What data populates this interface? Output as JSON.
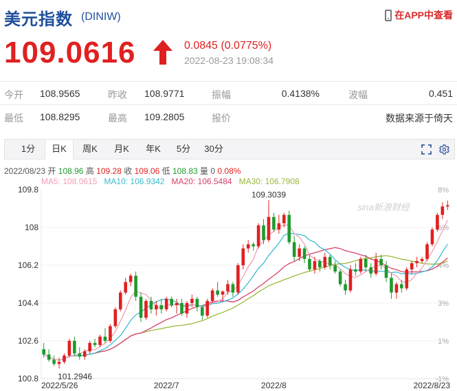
{
  "header": {
    "title": "美元指数",
    "code": "(DINIW)",
    "app_link": "在APP中查看",
    "icon": "phone-icon"
  },
  "quote": {
    "price": "109.0616",
    "arrow_icon": "up-arrow-icon",
    "change": "0.0845 (0.0775%)",
    "datetime": "2022-08-23 19:08:34"
  },
  "stats": {
    "row1": [
      {
        "label": "今开",
        "value": "108.9565"
      },
      {
        "label": "昨收",
        "value": "108.9771"
      },
      {
        "label": "振幅",
        "value": "0.4138%"
      },
      {
        "label": "波幅",
        "value": "0.451"
      }
    ],
    "row2": [
      {
        "label": "最低",
        "value": "108.8295"
      },
      {
        "label": "最高",
        "value": "109.2805"
      },
      {
        "label": "报价",
        "value": ""
      },
      {
        "label": "",
        "value": "数据来源于倚天"
      }
    ]
  },
  "tabs": [
    "1分",
    "日K",
    "周K",
    "月K",
    "年K",
    "5分",
    "30分"
  ],
  "active_tab": "日K",
  "toolbar_icons": [
    "fullscreen-icon",
    "settings-icon"
  ],
  "kline_info": {
    "date": "2022/08/23",
    "open_label": "开",
    "open": "108.96",
    "high_label": "高",
    "high": "109.28",
    "close_label": "收",
    "close": "109.06",
    "low_label": "低",
    "low": "108.83",
    "vol_label": "量",
    "vol": "0",
    "pct": "0.08%"
  },
  "ma_info": {
    "ma5": "MA5: 108.0615",
    "ma10": "MA10: 106.9342",
    "ma20": "MA20: 106.5484",
    "ma30": "MA30: 106.7908"
  },
  "colors": {
    "up": "#e02020",
    "down": "#1f9a2e",
    "ma5": "#f0a0b4",
    "ma10": "#3cbcd0",
    "ma20": "#d8406a",
    "ma30": "#9aba3a",
    "title": "#1f4e9c"
  },
  "chart_data": {
    "type": "candlestick",
    "y_ticks": [
      "109.8",
      "108",
      "106.2",
      "104.4",
      "102.6",
      "100.8"
    ],
    "y_ticks_right": [
      "8%",
      "6%",
      "4%",
      "3%",
      "1%",
      "-1%"
    ],
    "ylim": [
      100.8,
      109.8
    ],
    "x_labels": [
      "2022/5/26",
      "2022/7",
      "2022/8",
      "2022/8/23"
    ],
    "annotations": [
      {
        "text": "109.3039",
        "type": "max",
        "index": 44
      },
      {
        "text": "101.2946",
        "type": "min",
        "index": 3
      }
    ],
    "watermark": "sina新浪财经",
    "candles": [
      [
        102.2,
        102.5,
        101.8,
        101.95
      ],
      [
        101.95,
        102.2,
        101.6,
        101.7
      ],
      [
        101.7,
        101.9,
        101.4,
        101.5
      ],
      [
        101.5,
        101.8,
        101.29,
        101.6
      ],
      [
        101.6,
        102.0,
        101.5,
        101.9
      ],
      [
        101.9,
        102.7,
        101.8,
        102.6
      ],
      [
        102.6,
        102.8,
        101.9,
        102.0
      ],
      [
        102.0,
        102.3,
        101.7,
        101.85
      ],
      [
        101.85,
        102.2,
        101.7,
        102.1
      ],
      [
        102.1,
        102.6,
        102.0,
        102.5
      ],
      [
        102.5,
        102.7,
        102.3,
        102.4
      ],
      [
        102.4,
        102.9,
        102.3,
        102.8
      ],
      [
        102.8,
        103.2,
        102.5,
        102.6
      ],
      [
        102.6,
        103.4,
        102.5,
        103.3
      ],
      [
        103.3,
        104.2,
        103.2,
        104.1
      ],
      [
        104.1,
        105.0,
        104.0,
        104.9
      ],
      [
        104.9,
        105.6,
        104.8,
        105.4
      ],
      [
        105.4,
        105.8,
        105.2,
        105.7
      ],
      [
        105.7,
        105.9,
        104.5,
        104.7
      ],
      [
        104.7,
        104.9,
        103.5,
        103.7
      ],
      [
        103.7,
        104.6,
        103.6,
        104.5
      ],
      [
        104.5,
        104.7,
        103.9,
        104.1
      ],
      [
        104.1,
        104.5,
        103.8,
        104.3
      ],
      [
        104.3,
        104.6,
        103.9,
        104.1
      ],
      [
        104.1,
        104.7,
        104.0,
        104.6
      ],
      [
        104.6,
        104.7,
        104.2,
        104.3
      ],
      [
        104.3,
        104.6,
        103.9,
        104.4
      ],
      [
        104.4,
        104.6,
        103.8,
        103.9
      ],
      [
        103.9,
        104.5,
        103.7,
        104.4
      ],
      [
        104.4,
        104.8,
        104.2,
        104.6
      ],
      [
        104.6,
        104.7,
        104.0,
        104.2
      ],
      [
        104.2,
        104.3,
        103.6,
        103.8
      ],
      [
        103.8,
        104.6,
        103.7,
        104.5
      ],
      [
        104.5,
        105.1,
        104.4,
        105.0
      ],
      [
        105.0,
        105.4,
        104.7,
        104.8
      ],
      [
        104.8,
        105.0,
        104.5,
        104.95
      ],
      [
        104.95,
        105.5,
        104.8,
        105.3
      ],
      [
        105.3,
        105.4,
        104.7,
        104.9
      ],
      [
        104.9,
        106.3,
        104.8,
        106.2
      ],
      [
        106.2,
        107.2,
        106.0,
        107.0
      ],
      [
        107.0,
        107.4,
        106.8,
        107.2
      ],
      [
        107.2,
        107.3,
        106.9,
        107.1
      ],
      [
        107.1,
        108.2,
        107.0,
        108.1
      ],
      [
        108.1,
        108.4,
        107.2,
        107.4
      ],
      [
        107.4,
        109.3,
        107.3,
        108.5
      ],
      [
        108.5,
        108.7,
        107.8,
        107.9
      ],
      [
        107.9,
        108.6,
        107.7,
        108.2
      ],
      [
        108.2,
        108.7,
        108.0,
        108.6
      ],
      [
        108.6,
        108.8,
        107.2,
        107.3
      ],
      [
        107.3,
        107.6,
        106.4,
        106.6
      ],
      [
        106.6,
        107.2,
        106.4,
        107.0
      ],
      [
        107.0,
        107.1,
        106.3,
        106.5
      ],
      [
        106.5,
        106.7,
        105.9,
        106.0
      ],
      [
        106.0,
        106.6,
        105.8,
        106.4
      ],
      [
        106.4,
        106.5,
        105.9,
        106.1
      ],
      [
        106.1,
        106.8,
        106.0,
        106.6
      ],
      [
        106.6,
        106.7,
        106.0,
        106.2
      ],
      [
        106.2,
        106.4,
        105.8,
        105.9
      ],
      [
        105.9,
        106.0,
        105.2,
        105.3
      ],
      [
        105.3,
        105.5,
        104.8,
        105.0
      ],
      [
        105.0,
        106.2,
        104.9,
        106.0
      ],
      [
        106.0,
        106.3,
        105.7,
        105.9
      ],
      [
        105.9,
        106.6,
        105.8,
        106.5
      ],
      [
        106.5,
        106.7,
        105.9,
        106.1
      ],
      [
        106.1,
        106.3,
        105.6,
        105.8
      ],
      [
        105.8,
        106.8,
        105.7,
        106.5
      ],
      [
        106.5,
        106.7,
        106.0,
        106.2
      ],
      [
        106.2,
        106.4,
        105.4,
        105.6
      ],
      [
        105.6,
        105.8,
        104.6,
        104.9
      ],
      [
        104.9,
        105.4,
        104.6,
        105.3
      ],
      [
        105.3,
        105.5,
        104.9,
        105.1
      ],
      [
        105.1,
        106.1,
        105.0,
        106.0
      ],
      [
        106.0,
        106.4,
        105.8,
        106.3
      ],
      [
        106.3,
        106.6,
        106.1,
        106.4
      ],
      [
        106.4,
        106.6,
        106.3,
        106.5
      ],
      [
        106.5,
        107.3,
        106.4,
        107.2
      ],
      [
        107.2,
        108.0,
        107.1,
        107.9
      ],
      [
        107.9,
        108.7,
        107.8,
        108.6
      ],
      [
        108.6,
        109.2,
        108.4,
        109.0
      ],
      [
        109.0,
        109.28,
        108.83,
        109.06
      ]
    ]
  }
}
